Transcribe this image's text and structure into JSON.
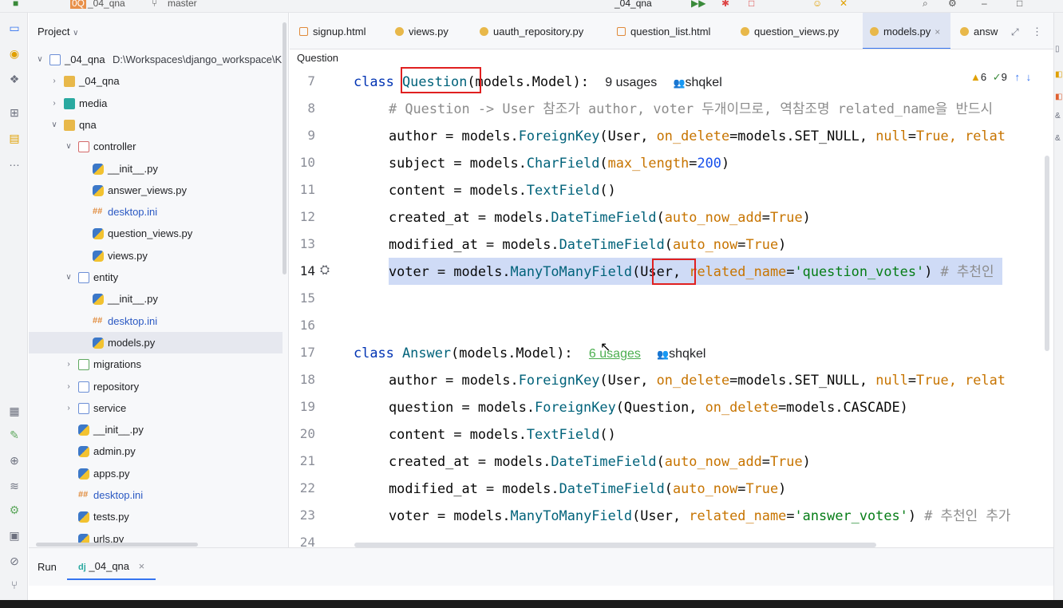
{
  "topbar": {
    "project_badge": "0Q",
    "project_name": "_04_qna",
    "branch": "master",
    "run_config": "_04_qna"
  },
  "sidebar": {
    "header": "Project",
    "tree": [
      {
        "label": "_04_qna",
        "suffix": "D:\\Workspaces\\django_workspace\\K",
        "arrow": "v"
      },
      {
        "label": "_04_qna",
        "arrow": ">"
      },
      {
        "label": "media",
        "arrow": ">"
      },
      {
        "label": "qna",
        "arrow": "v"
      },
      {
        "label": "controller",
        "arrow": "v"
      },
      {
        "label": "__init__.py",
        "arrow": ""
      },
      {
        "label": "answer_views.py",
        "arrow": ""
      },
      {
        "label": "desktop.ini",
        "arrow": ""
      },
      {
        "label": "question_views.py",
        "arrow": ""
      },
      {
        "label": "views.py",
        "arrow": ""
      },
      {
        "label": "entity",
        "arrow": "v"
      },
      {
        "label": "__init__.py",
        "arrow": ""
      },
      {
        "label": "desktop.ini",
        "arrow": ""
      },
      {
        "label": "models.py",
        "arrow": ""
      },
      {
        "label": "migrations",
        "arrow": ">"
      },
      {
        "label": "repository",
        "arrow": ">"
      },
      {
        "label": "service",
        "arrow": ">"
      },
      {
        "label": "__init__.py",
        "arrow": ""
      },
      {
        "label": "admin.py",
        "arrow": ""
      },
      {
        "label": "apps.py",
        "arrow": ""
      },
      {
        "label": "desktop.ini",
        "arrow": ""
      },
      {
        "label": "tests.py",
        "arrow": ""
      },
      {
        "label": "urls.py",
        "arrow": ""
      }
    ]
  },
  "tabs": [
    {
      "label": "signup.html"
    },
    {
      "label": "views.py"
    },
    {
      "label": "uauth_repository.py"
    },
    {
      "label": "question_list.html"
    },
    {
      "label": "question_views.py"
    },
    {
      "label": "models.py",
      "close": "×"
    },
    {
      "label": "answ"
    }
  ],
  "breadcrumb": "Question",
  "inspections": {
    "warnings": "6",
    "typos": "9"
  },
  "code": {
    "line_numbers": [
      "7",
      "8",
      "9",
      "10",
      "11",
      "12",
      "13",
      "14",
      "15",
      "16",
      "17",
      "18",
      "19",
      "20",
      "21",
      "22",
      "23",
      "24"
    ],
    "l7": {
      "kw": "class ",
      "name": "Question",
      "rest": "(models.Model):",
      "usages": "9 usages",
      "author": "shqkel"
    },
    "l8": "# Question -> User 참조가 author, voter 두개이므로, 역참조명 related_name을 반드시 ",
    "l9": {
      "a": "author = models.",
      "b": "ForeignKey",
      "c": "(User, ",
      "d": "on_delete",
      "e": "=models.SET_NULL, ",
      "f": "null",
      "g": "=",
      "h": "True",
      "i": ", relat"
    },
    "l10": {
      "a": "subject = models.",
      "b": "CharField",
      "c": "(",
      "d": "max_length",
      "e": "=",
      "f": "200",
      "g": ")"
    },
    "l11": {
      "a": "content = models.",
      "b": "TextField",
      "c": "()"
    },
    "l12": {
      "a": "created_at = models.",
      "b": "DateTimeField",
      "c": "(",
      "d": "auto_now_add",
      "e": "=",
      "f": "True",
      "g": ")"
    },
    "l13": {
      "a": "modified_at = models.",
      "b": "DateTimeField",
      "c": "(",
      "d": "auto_now",
      "e": "=",
      "f": "True",
      "g": ")"
    },
    "l14": {
      "a": "voter = models.",
      "b": "ManyToManyField",
      "c": "(User, ",
      "d": "related_name",
      "e": "=",
      "f": "'question_votes'",
      "g": ") ",
      "h": "# 추천인 "
    },
    "l17": {
      "kw": "class ",
      "name": "Answer",
      "rest": "(models.Model):",
      "usages": "6 usages",
      "author": "shqkel"
    },
    "l18": {
      "a": "author = models.",
      "b": "ForeignKey",
      "c": "(User, ",
      "d": "on_delete",
      "e": "=models.SET_NULL, ",
      "f": "null",
      "g": "=",
      "h": "True",
      "i": ", relat"
    },
    "l19": {
      "a": "question = models.",
      "b": "ForeignKey",
      "c": "(Question, ",
      "d": "on_delete",
      "e": "=models.CASCADE)"
    },
    "l20": {
      "a": "content = models.",
      "b": "TextField",
      "c": "()"
    },
    "l21": {
      "a": "created_at = models.",
      "b": "DateTimeField",
      "c": "(",
      "d": "auto_now_add",
      "e": "=",
      "f": "True",
      "g": ")"
    },
    "l22": {
      "a": "modified_at = models.",
      "b": "DateTimeField",
      "c": "(",
      "d": "auto_now",
      "e": "=",
      "f": "True",
      "g": ")"
    },
    "l23": {
      "a": "voter = models.",
      "b": "ManyToManyField",
      "c": "(User, ",
      "d": "related_name",
      "e": "=",
      "f": "'answer_votes'",
      "g": ") ",
      "h": "# 추천인 추가"
    }
  },
  "run_panel": {
    "label": "Run",
    "tab": "_04_qna",
    "close": "×"
  },
  "colors": {
    "accent": "#3574f0",
    "highlight_box": "#e02020",
    "selection": "#cfdbf6"
  }
}
